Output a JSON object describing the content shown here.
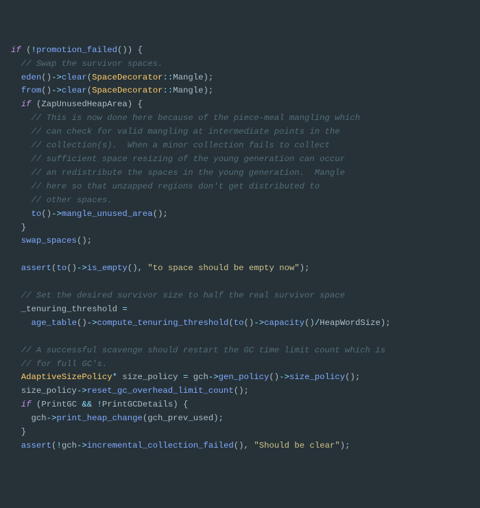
{
  "code": {
    "kw_if1": "if",
    "op_not1": "!",
    "fn_promotion_failed": "promotion_failed",
    "c_swap": "// Swap the survivor spaces.",
    "fn_eden": "eden",
    "op_arrow": "->",
    "fn_clear": "clear",
    "cls_SpaceDecorator": "SpaceDecorator",
    "op_scope": "::",
    "id_Mangle": "Mangle",
    "fn_from": "from",
    "kw_if2": "if",
    "id_ZapUnusedHeapArea": "ZapUnusedHeapArea",
    "c_piece1": "// This is now done here because of the piece-meal mangling which",
    "c_piece2": "// can check for valid mangling at intermediate points in the",
    "c_piece3": "// collection(s).  When a minor collection fails to collect",
    "c_piece4": "// sufficient space resizing of the young generation can occur",
    "c_piece5": "// an redistribute the spaces in the young generation.  Mangle",
    "c_piece6": "// here so that unzapped regions don't get distributed to",
    "c_piece7": "// other spaces.",
    "fn_to": "to",
    "fn_mangle_unused_area": "mangle_unused_area",
    "fn_swap_spaces": "swap_spaces",
    "fn_assert": "assert",
    "fn_is_empty": "is_empty",
    "str_to_empty": "\"to space should be empty now\"",
    "c_survivor": "// Set the desired survivor size to half the real survivor space",
    "id_tenuring": "_tenuring_threshold",
    "fn_age_table": "age_table",
    "fn_compute_tenuring": "compute_tenuring_threshold",
    "fn_capacity": "capacity",
    "id_HeapWordSize": "HeapWordSize",
    "c_succ1": "// A successful scavenge should restart the GC time limit count which is",
    "c_succ2": "// for full GC's.",
    "cls_AdaptiveSizePolicy": "AdaptiveSizePolicy",
    "id_size_policy": "size_policy",
    "id_gch": "gch",
    "fn_gen_policy": "gen_policy",
    "fn_size_policy": "size_policy",
    "fn_reset_gc": "reset_gc_overhead_limit_count",
    "kw_if3": "if",
    "id_PrintGC": "PrintGC",
    "op_and": "&&",
    "op_not2": "!",
    "id_PrintGCDetails": "PrintGCDetails",
    "fn_print_heap_change": "print_heap_change",
    "id_gch_prev_used": "gch_prev_used",
    "fn_incremental": "incremental_collection_failed",
    "str_clear": "\"Should be clear\"",
    "eq": " = ",
    "star": "*",
    "comma": ",",
    "semi": ";",
    "lp": "(",
    "rp": ")",
    "lb": "{",
    "rb": "}",
    "div": "/"
  }
}
